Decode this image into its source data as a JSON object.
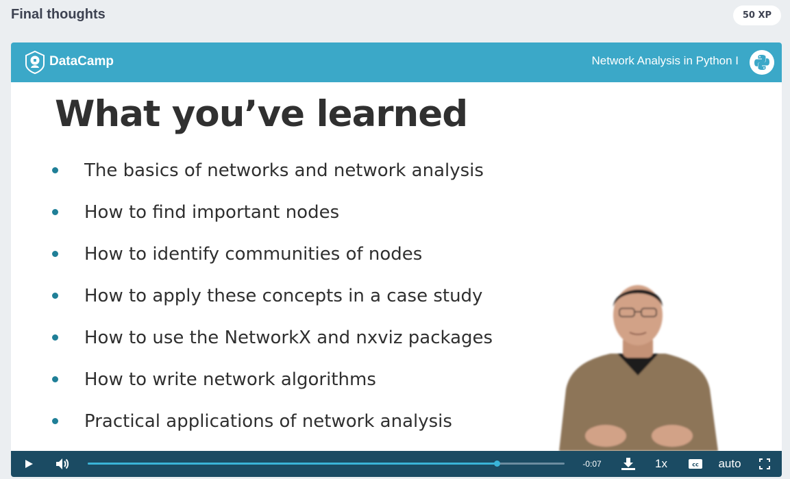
{
  "page": {
    "title": "Final thoughts",
    "xp_badge": "50 XP"
  },
  "slide": {
    "brand": "DataCamp",
    "course_title": "Network Analysis in Python I",
    "heading": "What you’ve learned",
    "bullets": [
      "The basics of networks and network analysis",
      "How to find important nodes",
      "How to identify communities of nodes",
      "How to apply these concepts in a case study",
      "How to use the NetworkX and nxviz packages",
      "How to write network algorithms",
      "Practical applications of network analysis"
    ]
  },
  "player": {
    "time_remaining": "-0:07",
    "progress_fraction": 0.858,
    "speed": "1x",
    "quality": "auto",
    "icons": [
      "play-icon",
      "volume-icon",
      "download-icon",
      "closed-captions-icon",
      "fullscreen-icon"
    ]
  },
  "colors": {
    "header": "#3ba8c8",
    "controls": "#1b4b63",
    "progress": "#3ab4d8",
    "bullet": "#1f7f97"
  }
}
